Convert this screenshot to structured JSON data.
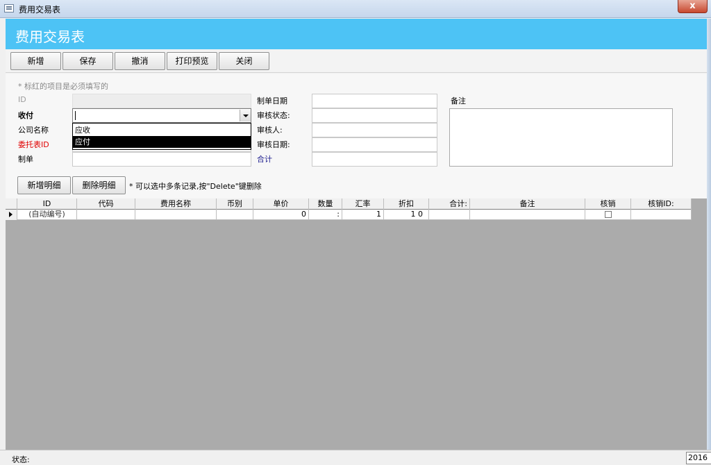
{
  "window": {
    "title": "费用交易表",
    "close_label": "x"
  },
  "header": {
    "title": "费用交易表"
  },
  "toolbar": {
    "buttons": [
      "新增",
      "保存",
      "撤消",
      "打印预览",
      "关闭"
    ]
  },
  "form": {
    "hint": "* 标红的项目是必须填写的",
    "labels": {
      "id": "ID",
      "shou_fu": "收付",
      "company": "公司名称",
      "weituo": "委托表ID",
      "zhidan": "制单",
      "zhidan_date": "制单日期",
      "audit_status": "审核状态:",
      "auditor": "审核人:",
      "audit_date": "审核日期:",
      "total": "合计",
      "remark": "备注"
    },
    "dropdown_options": [
      "应收",
      "应付"
    ],
    "detail_buttons": {
      "add": "新增明细",
      "delete": "删除明细"
    },
    "detail_hint": "* 可以选中多条记录,按\"Delete\"键删除"
  },
  "grid": {
    "columns": [
      "ID",
      "代码",
      "费用名称",
      "币别",
      "单价",
      "数量",
      "汇率",
      "折扣",
      "合计:",
      "备注",
      "核销",
      "核销ID:"
    ],
    "row": {
      "id": "(自动编号)",
      "price": "0",
      "qty": ":",
      "rate": "1",
      "discount": "1 0"
    }
  },
  "status": {
    "label": "状态:",
    "right_text": "2016"
  }
}
